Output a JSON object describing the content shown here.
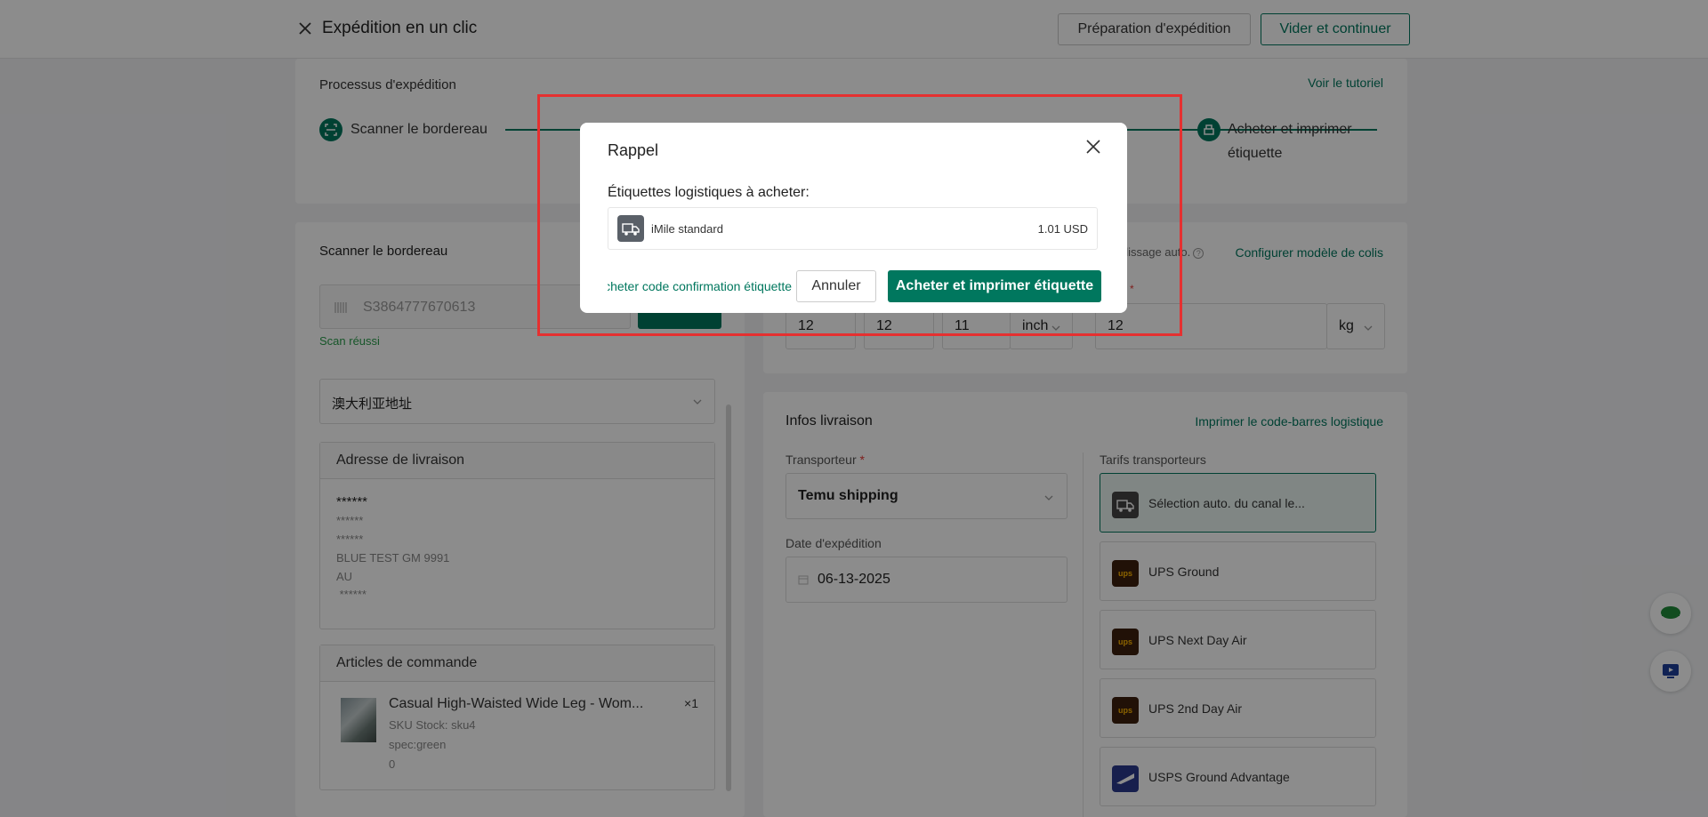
{
  "header": {
    "title": "Expédition en un clic",
    "btn_prep": "Préparation d'expédition",
    "btn_vider": "Vider et continuer"
  },
  "process": {
    "title": "Processus d'expédition",
    "tutorial": "Voir le tutoriel",
    "steps": [
      {
        "label": "Scanner le bordereau"
      },
      {
        "label": "Acheter et imprimer étiquette"
      }
    ]
  },
  "scan": {
    "title": "Scanner le bordereau",
    "input_value": "S3864777670613",
    "status": "Scan réussi",
    "address_select": "澳大利亚地址"
  },
  "address": {
    "title": "Adresse de livraison",
    "lines": [
      "******",
      "******",
      "******",
      "BLUE TEST  GM  9991",
      "AU",
      " ******"
    ]
  },
  "items": {
    "title": "Articles de commande",
    "name": "Casual High-Waisted Wide Leg - Wom...",
    "qty": "×1",
    "sku": "SKU Stock: sku4",
    "spec": "spec:green",
    "extra": "0"
  },
  "dims": {
    "auto_text": "plissage auto.",
    "config_link": "Configurer modèle de colis",
    "required": "*",
    "length": "12",
    "width": "12",
    "height": "11",
    "unit": "inch",
    "weight": "12",
    "weight_unit": "kg"
  },
  "shipping": {
    "title": "Infos livraison",
    "barcode_link": "Imprimer le code-barres logistique",
    "carrier_label": "Transporteur",
    "required": "*",
    "carrier_value": "Temu shipping",
    "date_label": "Date d'expédition",
    "date_value": "06-13-2025",
    "rates_label": "Tarifs transporteurs",
    "rates": [
      {
        "name": "Sélection auto. du canal le...",
        "logo": "truck-icon"
      },
      {
        "name": "UPS Ground",
        "logo": "ups-logo"
      },
      {
        "name": "UPS Next Day Air",
        "logo": "ups-logo"
      },
      {
        "name": "UPS 2nd Day Air",
        "logo": "ups-logo"
      },
      {
        "name": "USPS Ground Advantage",
        "logo": "usps-logo"
      }
    ]
  },
  "modal": {
    "title": "Rappel",
    "label": "Étiquettes logistiques à acheter:",
    "carrier": "iMile standard",
    "price": "1.01 USD",
    "link": "Acheter code confirmation étiquette",
    "cancel": "Annuler",
    "buy": "Acheter et imprimer étiquette"
  },
  "colors": {
    "accent": "#00775e",
    "highlight": "#e53030"
  }
}
